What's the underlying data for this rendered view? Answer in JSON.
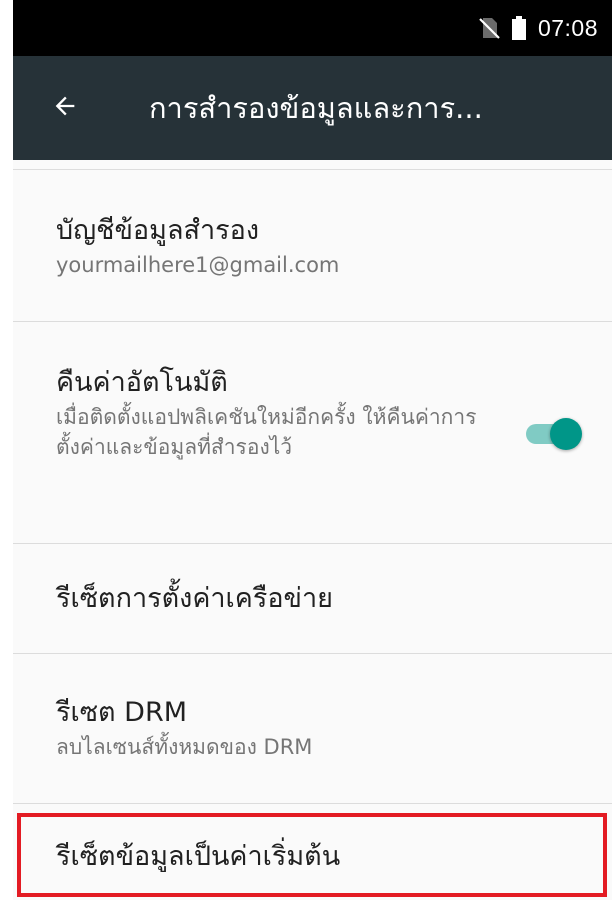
{
  "status_bar": {
    "time": "07:08",
    "icons": [
      "no-sim-icon",
      "battery-icon"
    ]
  },
  "app_bar": {
    "back_icon": "arrow-back-icon",
    "title": "การสำรองข้อมูลและการ..."
  },
  "settings": {
    "backup_account": {
      "title": "บัญชีข้อมูลสำรอง",
      "subtitle": "yourmailhere1@gmail.com"
    },
    "auto_restore": {
      "title": "คืนค่าอัตโนมัติ",
      "subtitle": "เมื่อติดตั้งแอปพลิเคชันใหม่อีกครั้ง ให้คืนค่าการตั้งค่าและข้อมูลที่สำรองไว้",
      "enabled": true
    },
    "network_reset": {
      "title": "รีเซ็ตการตั้งค่าเครือข่าย"
    },
    "drm_reset": {
      "title": "รีเซต DRM",
      "subtitle": "ลบไลเซนส์ทั้งหมดของ DRM"
    },
    "factory_reset": {
      "title": "รีเซ็ตข้อมูลเป็นค่าเริ่มต้น",
      "highlighted": true
    }
  },
  "colors": {
    "app_bar": "#263238",
    "accent": "#009688",
    "highlight_border": "#e31b23"
  }
}
